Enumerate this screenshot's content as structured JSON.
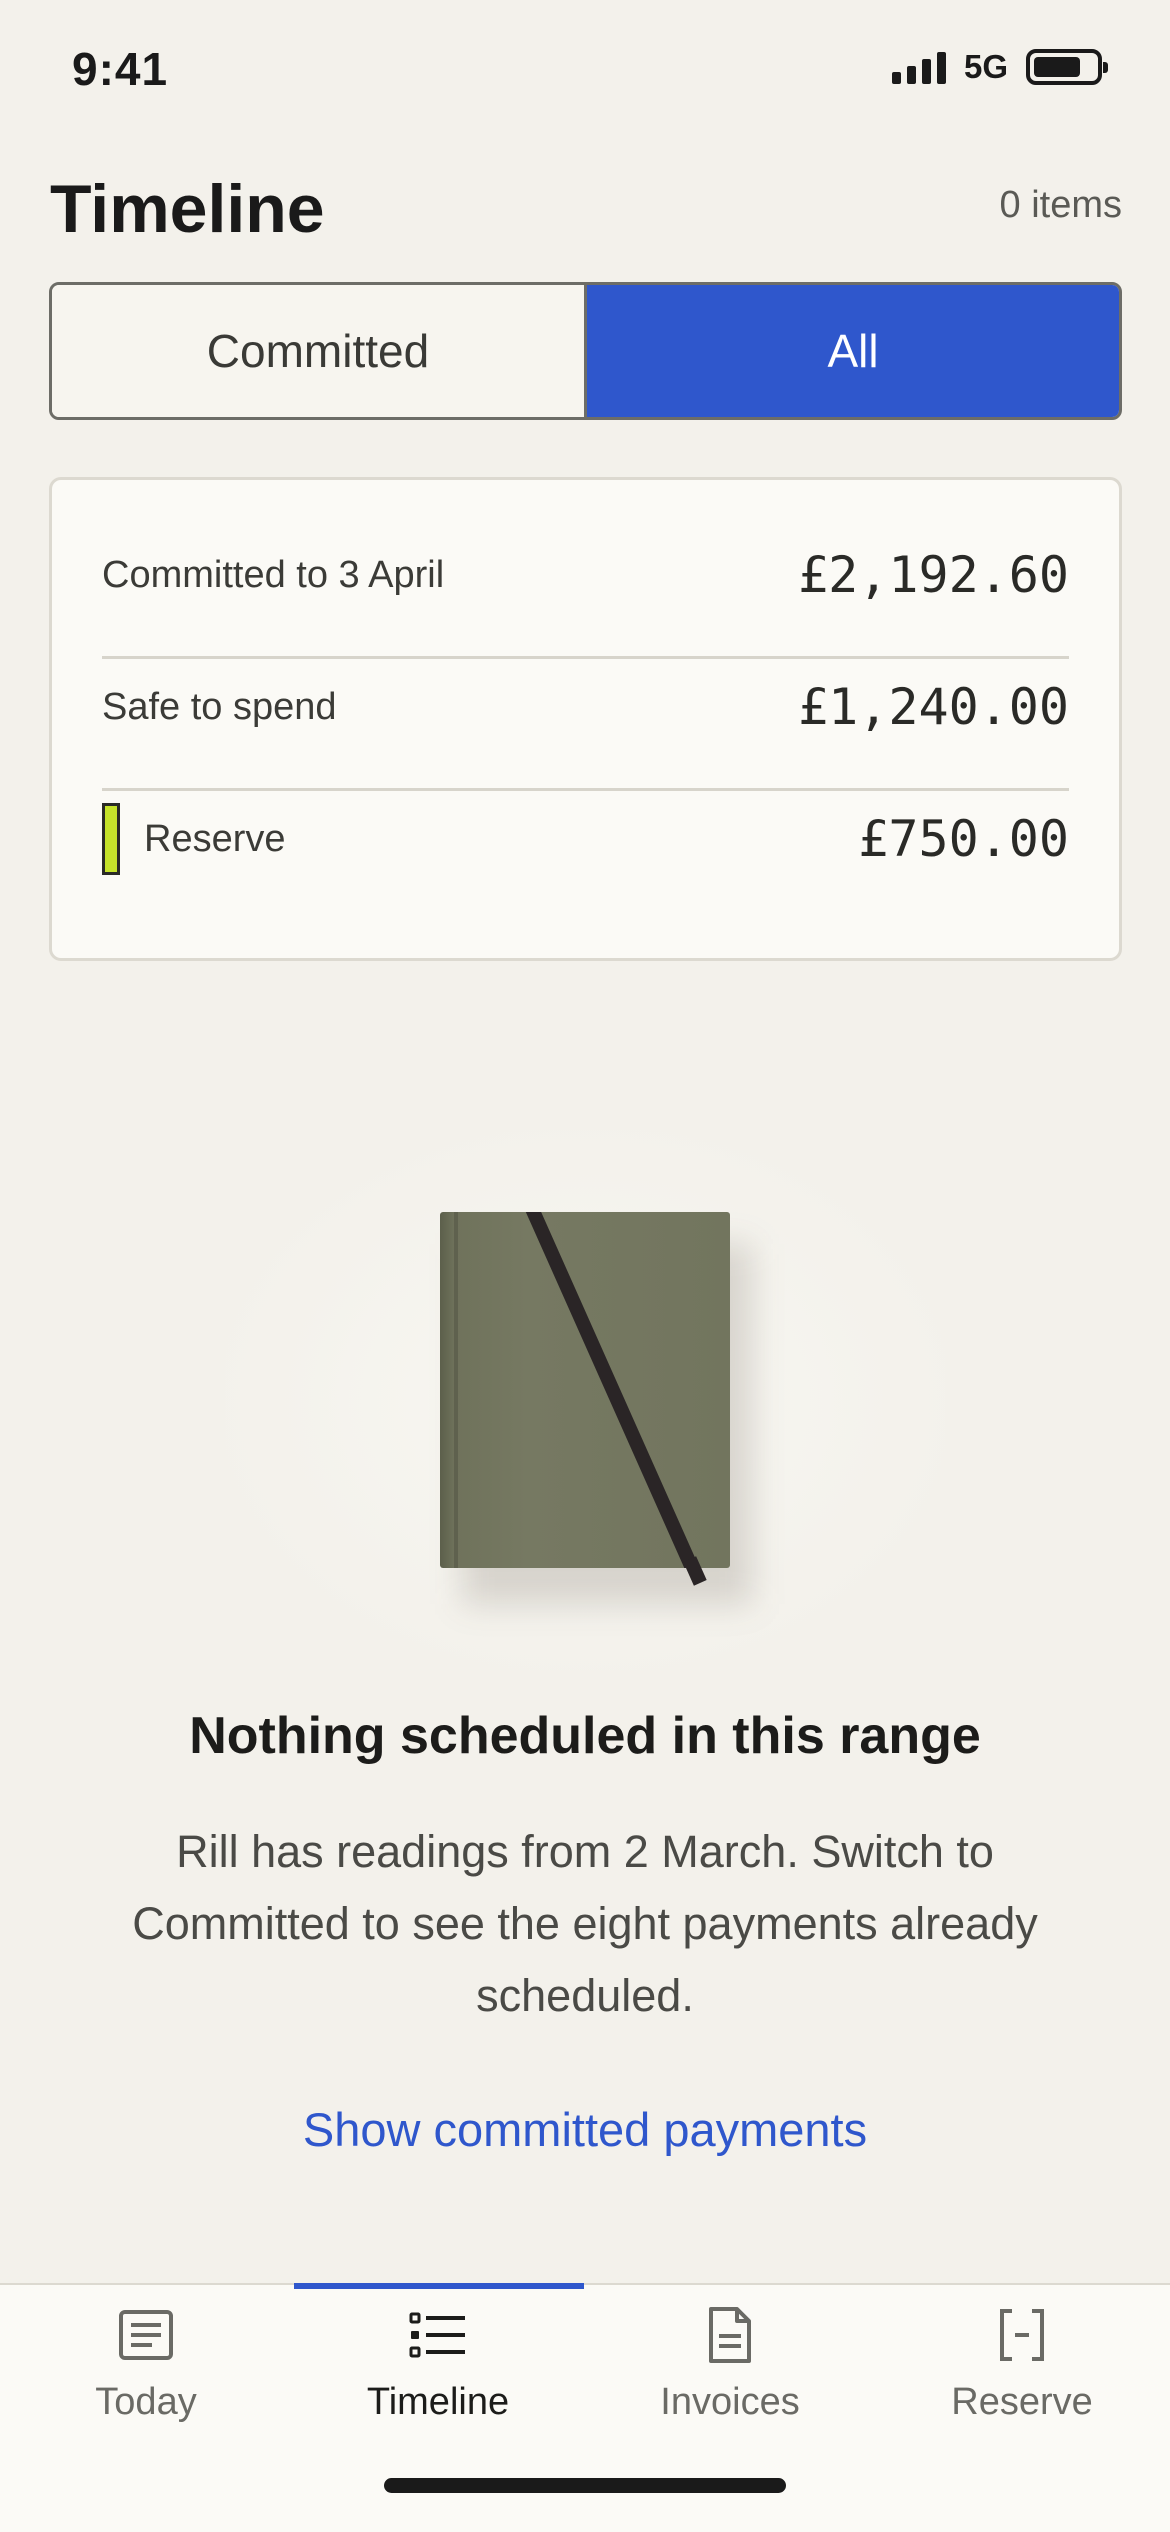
{
  "status_bar": {
    "time": "9:41",
    "network": "5G",
    "icons": [
      "signal-icon",
      "battery-icon"
    ]
  },
  "header": {
    "title": "Timeline",
    "item_count": "0 items"
  },
  "segmented_control": {
    "options": [
      "Committed",
      "All"
    ],
    "selected": "All"
  },
  "summary": {
    "rows": [
      {
        "label": "Committed to 3 April",
        "value": "£2,192.60"
      },
      {
        "label": "Safe to spend",
        "value": "£1,240.00"
      },
      {
        "label": "Reserve",
        "value": "£750.00",
        "marker_color": "#c6e32a"
      }
    ]
  },
  "empty_state": {
    "illustration": "notebook-illustration",
    "title": "Nothing scheduled in this range",
    "body": "Rill has readings from 2 March. Switch to Committed to see the eight payments already scheduled.",
    "link": "Show committed payments"
  },
  "tab_bar": {
    "tabs": [
      {
        "label": "Today",
        "icon": "today-icon"
      },
      {
        "label": "Timeline",
        "icon": "timeline-icon"
      },
      {
        "label": "Invoices",
        "icon": "invoice-icon"
      },
      {
        "label": "Reserve",
        "icon": "reserve-icon"
      }
    ],
    "selected": "Timeline"
  },
  "colors": {
    "accent": "#2f57cc",
    "background": "#f3f1eb",
    "reserve": "#c6e32a"
  }
}
